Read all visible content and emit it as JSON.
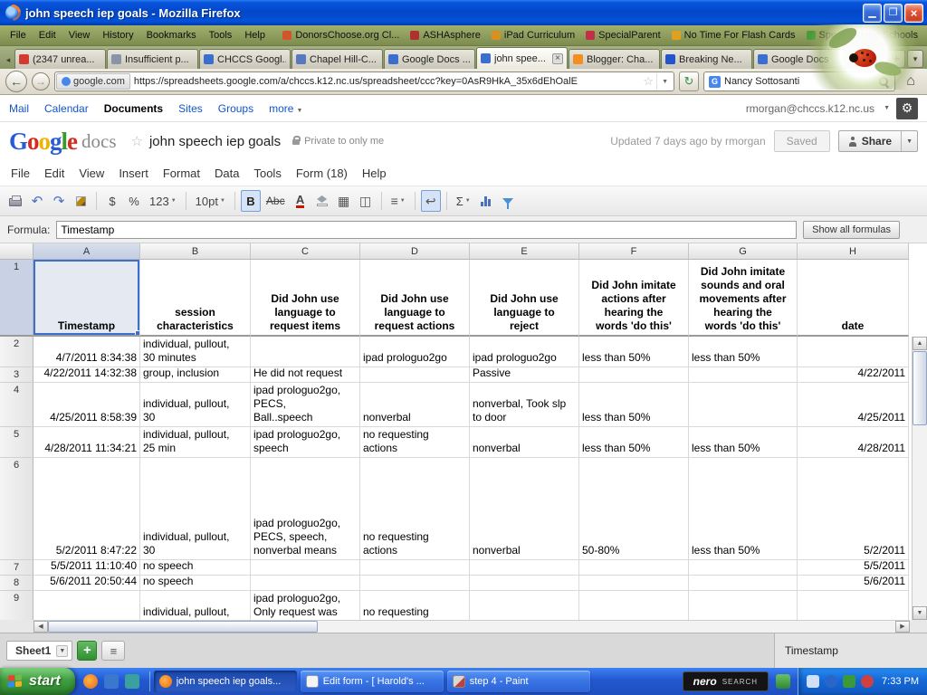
{
  "colors": {
    "xp_titlebar_blue": "#0855dd",
    "xp_taskbar_blue": "#2258d0",
    "start_button_green": "#3f9e3f",
    "persona_green": "#8a9a5a",
    "link_blue": "#1155cc",
    "selection_blue": "#3b6fd0",
    "close_button_red": "#e0563a"
  },
  "window": {
    "title": "john speech iep goals - Mozilla Firefox"
  },
  "browser": {
    "menus": [
      "File",
      "Edit",
      "View",
      "History",
      "Bookmarks",
      "Tools",
      "Help"
    ],
    "bookmarks": [
      "DonorsChoose.org Cl...",
      "ASHAsphere",
      "iPad Curriculum",
      "SpecialParent",
      "No Time For Flash Cards",
      "Speech in the Schools"
    ],
    "tabs": [
      "(2347 unrea...",
      "Insufficient p...",
      "CHCCS Googl...",
      "Chapel Hill-C...",
      "Google Docs ...",
      "john spee...",
      "Blogger: Cha...",
      "Breaking Ne...",
      "Google Docs"
    ],
    "site_identity": "google.com",
    "url": "https://spreadsheets.google.com/a/chccs.k12.nc.us/spreadsheet/ccc?key=0AsR9HkA_35x6dEhOalE",
    "search_value": "Nancy Sottosanti"
  },
  "google_bar": {
    "links": [
      "Mail",
      "Calendar",
      "Documents",
      "Sites",
      "Groups",
      "more"
    ],
    "account": "rmorgan@chccs.k12.nc.us"
  },
  "doc_header": {
    "logo_letters": [
      "G",
      "o",
      "o",
      "g",
      "l",
      "e"
    ],
    "logo_sub": "docs",
    "title": "john speech iep goals",
    "privacy": "Private to only me",
    "updated": "Updated 7 days ago by rmorgan",
    "saved_label": "Saved",
    "share_label": "Share"
  },
  "sheet": {
    "menus": [
      "File",
      "Edit",
      "View",
      "Insert",
      "Format",
      "Data",
      "Tools",
      "Form (18)",
      "Help"
    ],
    "toolbar": {
      "currency": "$",
      "percent": "%",
      "number_format": "123",
      "font_size": "10pt",
      "bold": "B",
      "strike": "Abc",
      "text_color": "A",
      "sum": "Σ"
    },
    "formula_label": "Formula:",
    "formula_value": "Timestamp",
    "show_all_formulas": "Show all formulas",
    "sheet_tab": "Sheet1",
    "statusbar_value": "Timestamp"
  },
  "grid": {
    "col_letters": [
      "A",
      "B",
      "C",
      "D",
      "E",
      "F",
      "G",
      "H"
    ],
    "row_numbers": [
      "1",
      "2",
      "3",
      "4",
      "5",
      "6",
      "7",
      "8",
      "9"
    ],
    "headers": [
      "Timestamp",
      "session\ncharacteristics",
      "Did John use\nlanguage to\nrequest items",
      "Did John use\nlanguage to\nrequest actions",
      "Did John use\nlanguage to\nreject",
      "Did John imitate\nactions after\nhearing the\nwords 'do this'",
      "Did John imitate\nsounds and oral\nmovements after\nhearing the\nwords 'do this'",
      "date"
    ],
    "rows": [
      [
        "4/7/2011 8:34:38",
        "individual, pullout,\n30 minutes",
        "",
        "ipad prologuo2go",
        "ipad prologuo2go",
        "less than 50%",
        "less than 50%",
        ""
      ],
      [
        "4/22/2011 14:32:38",
        "group, inclusion",
        "He did not request",
        "",
        "Passive",
        "",
        "",
        "4/22/2011"
      ],
      [
        "4/25/2011 8:58:39",
        "individual, pullout,\n30",
        "ipad prologuo2go,\nPECS,\nBall..speech",
        "nonverbal",
        "nonverbal, Took slp\nto door",
        "less than 50%",
        "",
        "4/25/2011"
      ],
      [
        "4/28/2011 11:34:21",
        "individual, pullout,\n25 min",
        "ipad prologuo2go,\nspeech",
        "no requesting\nactions",
        "nonverbal",
        "less than 50%",
        "less than 50%",
        "4/28/2011"
      ],
      [
        "5/2/2011 8:47:22",
        "individual, pullout,\n30",
        "ipad prologuo2go,\nPECS, speech,\nnonverbal means",
        "no requesting\nactions",
        "nonverbal",
        "50-80%",
        "less than 50%",
        "5/2/2011"
      ],
      [
        "5/5/2011 11:10:40",
        "no speech",
        "",
        "",
        "",
        "",
        "",
        "5/5/2011"
      ],
      [
        "5/6/2011 20:50:44",
        "no speech",
        "",
        "",
        "",
        "",
        "",
        "5/6/2011"
      ],
      [
        "",
        "individual, pullout,",
        "ipad prologuo2go,\nOnly request was",
        "no requesting",
        "",
        "",
        "",
        ""
      ]
    ]
  },
  "taskbar": {
    "start": "start",
    "tasks": [
      "john speech iep goals...",
      "Edit form - [ Harold's ...",
      "step 4 - Paint"
    ],
    "nero": "nero",
    "nero_sub": "SEARCH",
    "clock": "7:33 PM"
  }
}
